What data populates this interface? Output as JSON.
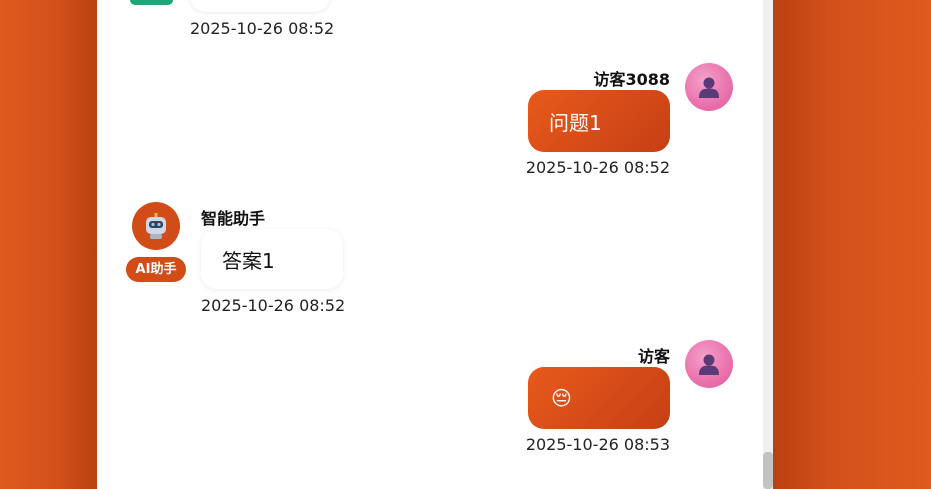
{
  "messages": [
    {
      "role": "assistant",
      "time": "2025-10-26 08:52"
    },
    {
      "role": "user",
      "sender": "访客3088",
      "text": "问题1",
      "time": "2025-10-26 08:52",
      "avatar_icon": "user-silhouette-icon"
    },
    {
      "role": "assistant",
      "sender": "智能助手",
      "badge": "AI助手",
      "text": "答案1",
      "time": "2025-10-26 08:52",
      "avatar_icon": "robot-icon"
    },
    {
      "role": "user",
      "sender": "访客",
      "text": "😔",
      "time": "2025-10-26 08:53",
      "avatar_icon": "user-silhouette-icon"
    }
  ],
  "colors": {
    "page_background": "#e05a1e",
    "user_bubble": "#d94d18",
    "bot_avatar": "#d24c17",
    "user_avatar": "#e86aa8",
    "panel": "#ffffff"
  }
}
